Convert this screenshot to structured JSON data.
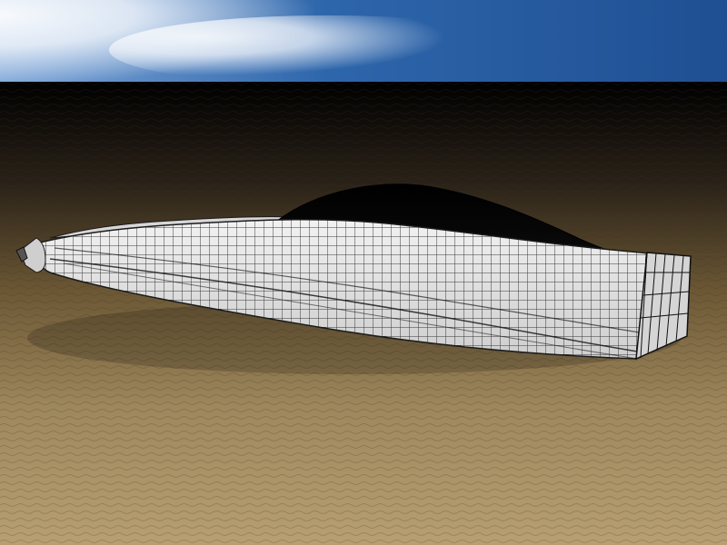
{
  "scene": {
    "description_visible_text": "",
    "sky_colors": {
      "top": "#1f4f93",
      "mid": "#2e66ab",
      "cloud": "#f3f6fa"
    },
    "ground_colors": {
      "far": "#000000",
      "mid": "#6b5734",
      "near": "#b79f73"
    },
    "model": {
      "wire_color": "#1b1b1b",
      "surface_color": "#dcdcdc",
      "canopy_color": "#050505"
    }
  }
}
